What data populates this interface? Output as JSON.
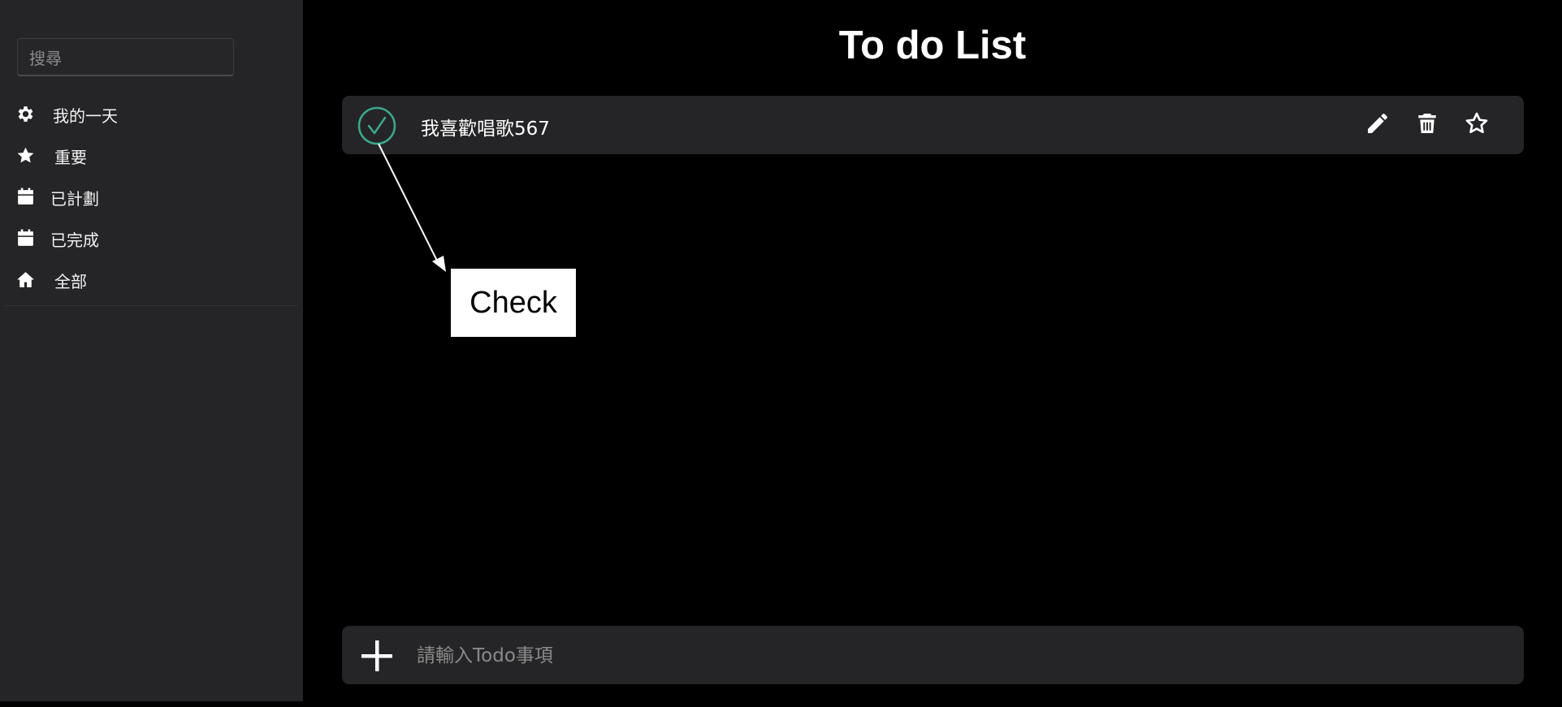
{
  "sidebar": {
    "search_placeholder": "搜尋",
    "items": [
      {
        "label": "我的一天",
        "icon": "gear-icon"
      },
      {
        "label": "重要",
        "icon": "star-icon"
      },
      {
        "label": "已計劃",
        "icon": "calendar-icon"
      },
      {
        "label": "已完成",
        "icon": "calendar-icon"
      },
      {
        "label": "全部",
        "icon": "home-icon"
      }
    ]
  },
  "main": {
    "title": "To do List",
    "todos": [
      {
        "text": "我喜歡唱歌567",
        "checked": true
      }
    ],
    "add_placeholder": "請輸入Todo事項"
  },
  "annotation": {
    "label": "Check"
  },
  "colors": {
    "check_accent": "#3aa88a",
    "sidebar_bg": "#252527",
    "main_bg": "#000000"
  }
}
